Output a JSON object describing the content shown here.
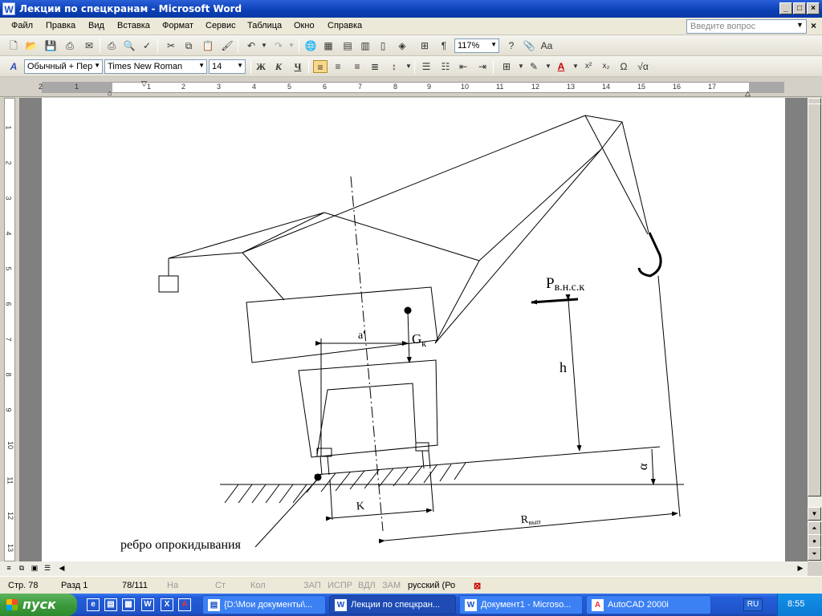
{
  "window": {
    "title": "Лекции по спецкранам - Microsoft Word",
    "minimize": "_",
    "maximize": "□",
    "close": "×"
  },
  "menu": {
    "items": [
      "Файл",
      "Правка",
      "Вид",
      "Вставка",
      "Формат",
      "Сервис",
      "Таблица",
      "Окно",
      "Справка"
    ],
    "help_placeholder": "Введите вопрос",
    "doc_close": "×"
  },
  "toolbar": {
    "zoom": "117%",
    "style": "Обычный + Пер",
    "font": "Times New Roman",
    "size": "14",
    "bold": "Ж",
    "italic": "К",
    "underline": "Ч"
  },
  "ruler": {
    "h_numbers": [
      "2",
      "1",
      "1",
      "2",
      "3",
      "4",
      "5",
      "6",
      "7",
      "8",
      "9",
      "10",
      "11",
      "12",
      "13",
      "14",
      "15",
      "16",
      "17"
    ],
    "v_numbers": [
      "1",
      "2",
      "3",
      "4",
      "5",
      "6",
      "7",
      "8",
      "9",
      "10",
      "11",
      "12",
      "13"
    ]
  },
  "drawing": {
    "label_force": "P",
    "label_force_sub": "в.н.с.к",
    "label_gk": "G",
    "label_gk_sub": "к",
    "label_a": "a'",
    "label_h": "h",
    "label_alpha": "α",
    "label_k": "K",
    "label_r": "R",
    "label_r_sub": "вып",
    "caption": "ребро опрокидывания"
  },
  "status": {
    "page": "Стр. 78",
    "section": "Разд 1",
    "pages": "78/111",
    "at": "На",
    "line": "Ст",
    "col": "Кол",
    "rec": "ЗАП",
    "trk": "ИСПР",
    "ext": "ВДЛ",
    "ovr": "ЗАМ",
    "language": "русский (Ро"
  },
  "taskbar": {
    "start": "пуск",
    "tasks": [
      "{D:\\Мои документы\\...",
      "Лекции по спецкран...",
      "Документ1 - Microso...",
      "AutoCAD 2000i"
    ],
    "lang": "RU",
    "clock": "8:55"
  }
}
